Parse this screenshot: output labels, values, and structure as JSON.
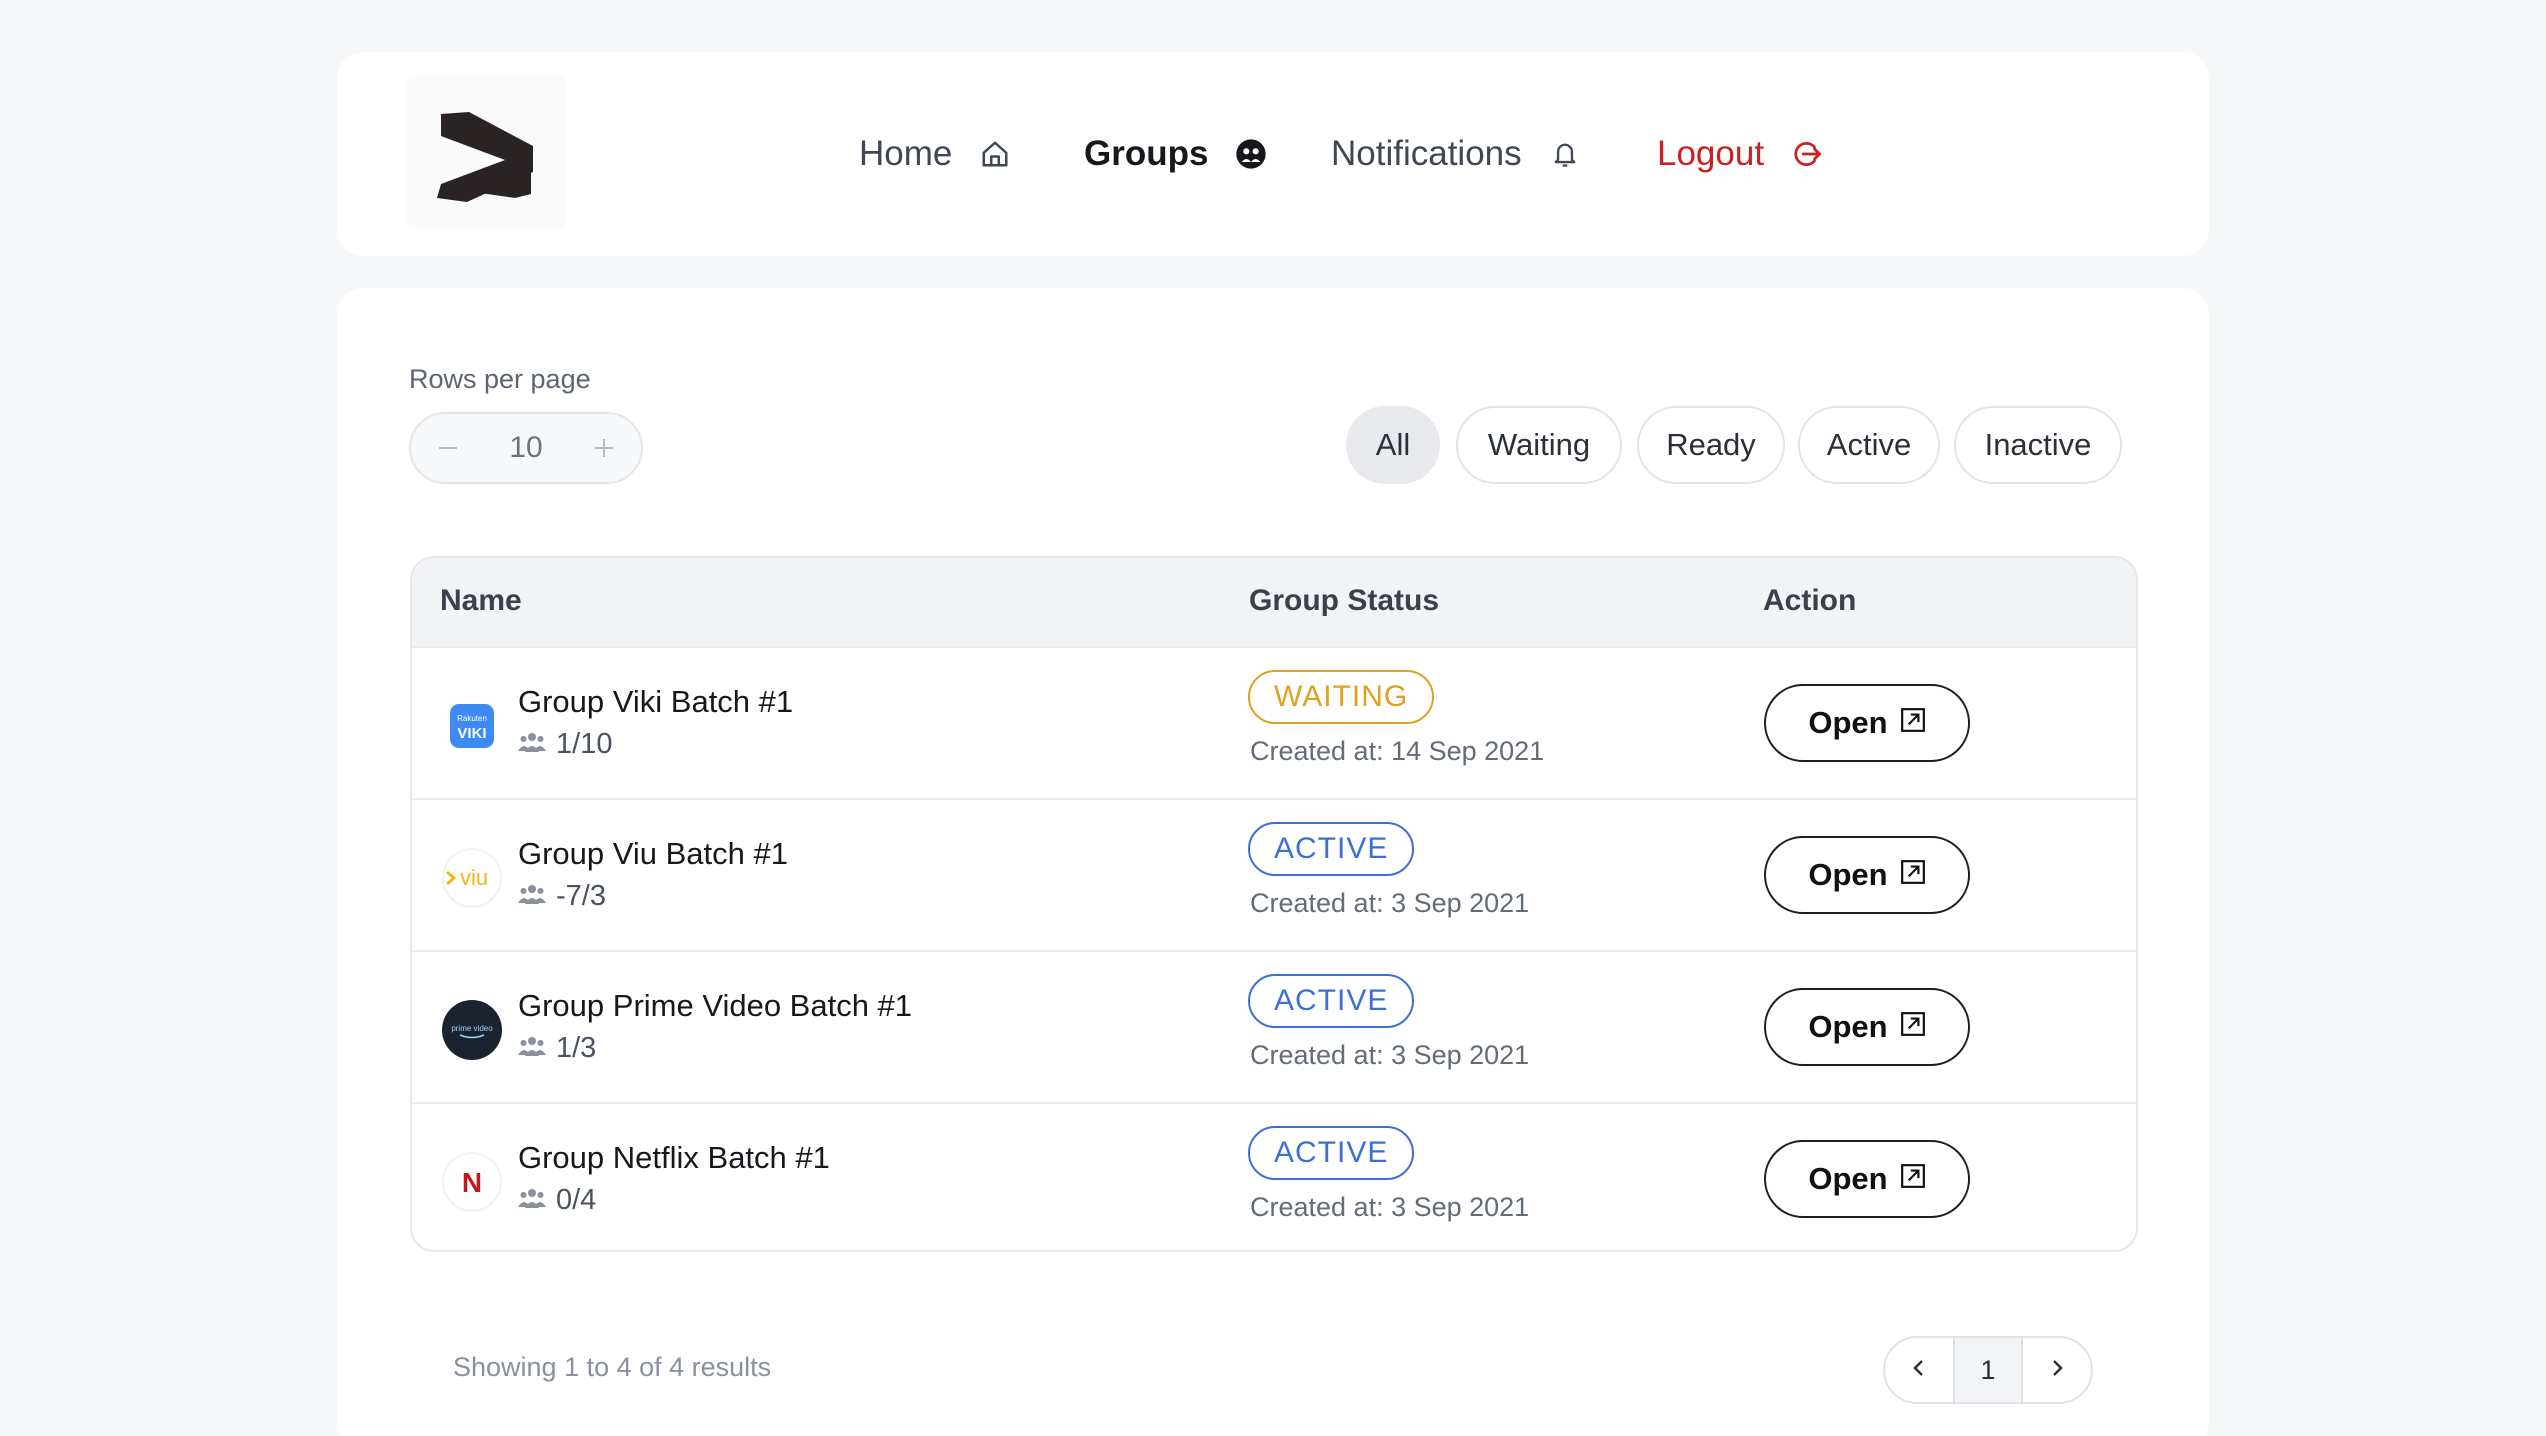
{
  "nav": {
    "home": "Home",
    "groups": "Groups",
    "notifications": "Notifications",
    "logout": "Logout",
    "active_item": "Groups",
    "logout_color": "#cc2020"
  },
  "controls": {
    "rows_label": "Rows per page",
    "rows_value": "10",
    "filters": [
      "All",
      "Waiting",
      "Ready",
      "Active",
      "Inactive"
    ],
    "selected_filter": "All"
  },
  "table": {
    "headers": {
      "name": "Name",
      "status": "Group Status",
      "action": "Action"
    },
    "rows": [
      {
        "name": "Group Viki Batch #1",
        "members": "1/10",
        "status": "WAITING",
        "created": "Created at: 14 Sep 2021",
        "action": "Open",
        "logo": "viki-logo",
        "logo_text": "VIKI"
      },
      {
        "name": "Group Viu Batch #1",
        "members": "-7/3",
        "status": "ACTIVE",
        "created": "Created at: 3 Sep 2021",
        "action": "Open",
        "logo": "viu-logo",
        "logo_text": "viu"
      },
      {
        "name": "Group Prime Video Batch #1",
        "members": "1/3",
        "status": "ACTIVE",
        "created": "Created at: 3 Sep 2021",
        "action": "Open",
        "logo": "prime-video-logo",
        "logo_text": "prime video"
      },
      {
        "name": "Group Netflix Batch #1",
        "members": "0/4",
        "status": "ACTIVE",
        "created": "Created at: 3 Sep 2021",
        "action": "Open",
        "logo": "netflix-logo",
        "logo_text": "N"
      }
    ],
    "status_colors": {
      "WAITING": "#e0a020",
      "ACTIVE": "#3b6fd8"
    }
  },
  "footer": {
    "showing": "Showing 1 to 4 of 4 results",
    "current_page": "1"
  },
  "icons": [
    "home-icon",
    "groups-icon",
    "bell-icon",
    "logout-icon",
    "minus-icon",
    "plus-icon",
    "users-icon",
    "external-link-icon",
    "chevron-left-icon",
    "chevron-right-icon"
  ]
}
